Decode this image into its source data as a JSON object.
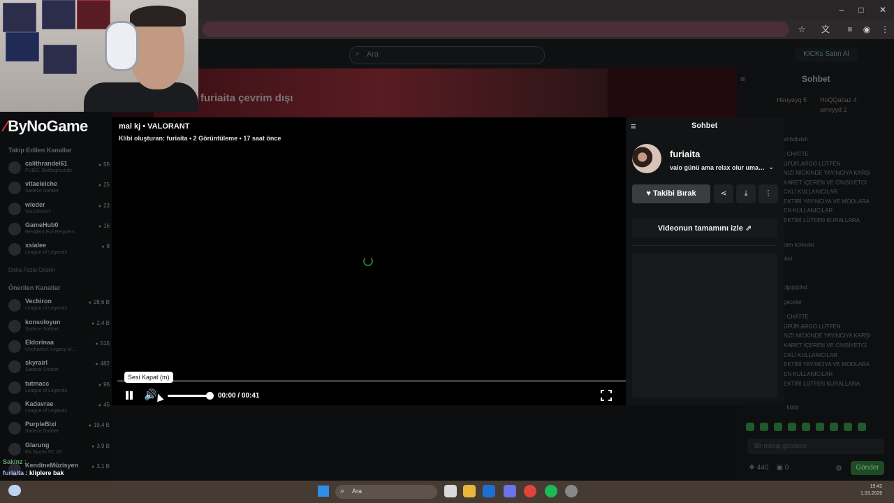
{
  "browser": {
    "window_controls": {
      "minimize": "–",
      "maximize": "□",
      "close": "✕"
    },
    "toolbar_icons": [
      "star-icon",
      "translate-icon",
      "reading-list-icon",
      "profile-icon",
      "menu-icon"
    ]
  },
  "site": {
    "search_placeholder": "Ara",
    "kicks_button": "KICKs Satın Al",
    "offline_banner": "furiaita çevrim dışı",
    "logo_text": "ByNoGame"
  },
  "sidebar": {
    "followed_heading": "Takip Edilen Kanallar",
    "followed": [
      {
        "name": "calithrandel61",
        "game": "PUBG: Battlegrounds",
        "viewers": "55"
      },
      {
        "name": "vitaeleiche",
        "game": "Sadece Sohbet",
        "viewers": "25"
      },
      {
        "name": "wleder",
        "game": "VALORANT",
        "viewers": "23"
      },
      {
        "name": "GameHub0",
        "game": "Resident Evil Requiem",
        "viewers": "16"
      },
      {
        "name": "xsialee",
        "game": "League of Legends",
        "viewers": "8"
      }
    ],
    "show_more": "Daha Fazla Göster",
    "recommended_heading": "Önerilen Kanallar",
    "recommended": [
      {
        "name": "Vechiron",
        "game": "League of Legends",
        "viewers": "28,6 B"
      },
      {
        "name": "konsoloyun",
        "game": "Sadece Sohbet",
        "viewers": "2,4 B"
      },
      {
        "name": "Eldorinaa",
        "game": "Uncharted: Legacy of...",
        "viewers": "515"
      },
      {
        "name": "skyrairl",
        "game": "Sadece Sohbet",
        "viewers": "482"
      },
      {
        "name": "tutmacc",
        "game": "League of Legends",
        "viewers": "96"
      },
      {
        "name": "Kadavrae",
        "game": "League of Legends",
        "viewers": "45"
      },
      {
        "name": "PurpleBixi",
        "game": "Sadece Sohbet",
        "viewers": "19,4 B"
      },
      {
        "name": "Glarung",
        "game": "EA Sports FC 26",
        "viewers": "3,9 B"
      },
      {
        "name": "KendineMüzisyen",
        "game": "",
        "viewers": "3,1 B"
      }
    ]
  },
  "bg_chat": {
    "title": "Sohbet",
    "leaderboard": [
      {
        "name": "Heuyeyq",
        "score": "5"
      },
      {
        "name": "HoQQabaz",
        "score": "4"
      },
      {
        "name": "umvyyd",
        "score": "2"
      }
    ],
    "lines": [
      "xhhdhdxh",
      ": CHATTE",
      "ÜFÜR,ARGO LÜTFEN",
      "NIZI NİCKİNDE YAYINCIYA KARŞI",
      "KARET İÇEREN VE CİNSİYETCİ",
      "CKLİ KULLANICILAR",
      "EKTİRİ YAYINCIYA VE MODLARA",
      "EN KULLANICILAR",
      "EKTİRİ LÜTFEN KURALLARA",
      "den korkular",
      "ileri",
      "djjxjdjdhd",
      "geceler",
      ": CHATTE",
      "ÜFÜR,ARGO LÜTFEN",
      "NIZI NİCKİNDE YAYINCIYA KARŞI",
      "KARET İÇEREN VE CİNSİYETCİ",
      "CKLİ KULLANICILAR",
      "EKTİRİ YAYINCIYA VE MODLARA",
      "EN KULLANICILAR",
      "EKTİRİ LÜTFEN KURALLARA",
      ": küfür"
    ],
    "input_placeholder": "Bir mesaj gönderin",
    "kicks_count": "440",
    "gift_count": "0",
    "send_button": "Gönder"
  },
  "clip": {
    "title": "mal kj • VALORANT",
    "meta": "Klibi oluşturan: furiaita • 2 Görüntüleme • 17 saat önce",
    "time": "00:00 / 00:41",
    "tooltip": "Sesi Kapat (m)",
    "progress": 0,
    "volume": 1
  },
  "panel": {
    "title": "Sohbet",
    "streamer": "furiaita",
    "stream_title": "valo günü ama relax olur umarım",
    "follow_button": "Takibi Bırak",
    "watch_full": "Videonun tamamını izle"
  },
  "overlay": {
    "chat_user1": "Sakinz :",
    "chat_user2": "furiaita",
    "chat_msg2": ": kliplere bak"
  },
  "taskbar": {
    "search_placeholder": "Ara",
    "time": "19:42",
    "date": "1.03.2026"
  },
  "colors": {
    "accent_green": "#53fc18",
    "follow_bg": "#3a3c3f",
    "panel_bg": "#121314"
  }
}
